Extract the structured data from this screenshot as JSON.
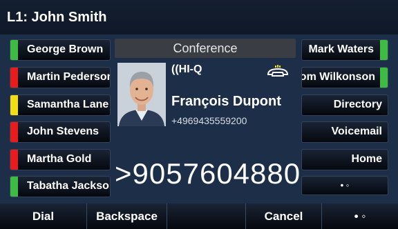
{
  "header": {
    "title": "L1: John Smith"
  },
  "left_keys": [
    {
      "label": "George Brown",
      "led": "green"
    },
    {
      "label": "Martin Pederson",
      "led": "red"
    },
    {
      "label": "Samantha Lane",
      "led": "yellow"
    },
    {
      "label": "John Stevens",
      "led": "red"
    },
    {
      "label": "Martha Gold",
      "led": "red"
    },
    {
      "label": "Tabatha Jackson",
      "led": "green"
    }
  ],
  "right_keys": [
    {
      "label": "Mark Waters",
      "led": "green"
    },
    {
      "label": "Tom Wilkonson",
      "led": "green"
    },
    {
      "label": "Directory",
      "led": ""
    },
    {
      "label": "Voicemail",
      "led": ""
    },
    {
      "label": "Home",
      "led": ""
    }
  ],
  "pager": {
    "label": "• ◦"
  },
  "center": {
    "header": "Conference",
    "brand": "((HI-Q",
    "contact_name": "François Dupont",
    "contact_number": "+4969435559200",
    "dialed_number": ">9057604880"
  },
  "softkeys": [
    {
      "label": "Dial"
    },
    {
      "label": "Backspace"
    },
    {
      "label": ""
    },
    {
      "label": "Cancel"
    },
    {
      "label": "• ◦"
    }
  ],
  "icons": {
    "handset": "handset-icon",
    "avatar": "contact-photo"
  },
  "colors": {
    "green": "#3dbb43",
    "red": "#e81c1c",
    "yellow": "#f2de16",
    "background": "#1d2f48"
  }
}
